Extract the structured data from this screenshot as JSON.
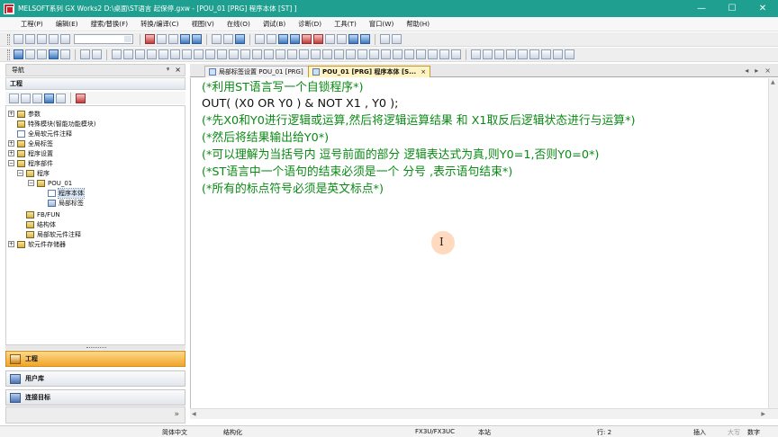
{
  "window": {
    "title": "MELSOFT系列 GX Works2 D:\\桌面\\ST语言  起保停.gxw - [POU_01 [PRG] 程序本体 [ST] ]",
    "minimize": "—",
    "maximize": "☐",
    "close": "✕"
  },
  "menu": [
    "工程(P)",
    "编辑(E)",
    "搜索/替换(F)",
    "转换/编译(C)",
    "视图(V)",
    "在线(O)",
    "调试(B)",
    "诊断(D)",
    "工具(T)",
    "窗口(W)",
    "帮助(H)"
  ],
  "navigation": {
    "header": "导航",
    "pin": "ᵠ",
    "close": "×",
    "section": "工程",
    "tree": [
      {
        "label": "参数",
        "expander": "+"
      },
      {
        "label": "特殊模块(智能功能模块)",
        "expander": ""
      },
      {
        "label": "全局软元件注释",
        "expander": ""
      },
      {
        "label": "全局标签",
        "expander": "+"
      },
      {
        "label": "程序设置",
        "expander": "+"
      },
      {
        "label": "程序部件",
        "expander": "−"
      },
      {
        "label": "程序",
        "expander": "−"
      },
      {
        "label": "POU_01",
        "expander": "−"
      },
      {
        "label": "程序本体",
        "expander": ""
      },
      {
        "label": "局部标签",
        "expander": ""
      },
      {
        "label": "FB/FUN",
        "expander": ""
      },
      {
        "label": "结构体",
        "expander": ""
      },
      {
        "label": "局部软元件注释",
        "expander": ""
      },
      {
        "label": "软元件存储器",
        "expander": "+"
      }
    ],
    "panels": [
      "工程",
      "用户库",
      "连接目标"
    ]
  },
  "tabs": [
    {
      "label": "局部标签设置 POU_01 [PRG]",
      "close": "×"
    },
    {
      "label": "POU_01 [PRG] 程序本体 [S...",
      "close": "×"
    }
  ],
  "tab_nav": {
    "left": "◂",
    "right": "▸",
    "close": "×"
  },
  "editor": {
    "lines": [
      {
        "text": "(*利用ST语言写一个自锁程序*)",
        "kind": "comment"
      },
      {
        "text": "OUT( (X0 OR Y0 ) & NOT X1  , Y0  );",
        "kind": "code"
      },
      {
        "text": "(*先X0和Y0进行逻辑或运算,然后将逻辑运算结果   和     X1取反后逻辑状态进行与运算*)",
        "kind": "comment"
      },
      {
        "text": "(*然后将结果输出给Y0*)",
        "kind": "comment"
      },
      {
        "text": "(*可以理解为当括号内    逗号前面的部分    逻辑表达式为真,则Y0=1,否则Y0=0*)",
        "kind": "comment"
      },
      {
        "text": "(*ST语言中一个语句的结束必须是一个   分号    ,表示语句结束*)",
        "kind": "comment"
      },
      {
        "text": "(*所有的标点符号必须是英文标点*)",
        "kind": "comment"
      }
    ],
    "cursor_glyph": "I"
  },
  "status": {
    "language": "简体中文",
    "mode": "结构化",
    "cpu": "FX3U/FX3UC",
    "station": "本站",
    "line": "行: 2",
    "insert": "插入",
    "caps": "大写",
    "num": "数字"
  },
  "colors": {
    "titlebar": "#1e9f8f",
    "comment": "#0a8a14",
    "active_tab": "#fff3c4",
    "active_panel": "#f2a52a"
  }
}
